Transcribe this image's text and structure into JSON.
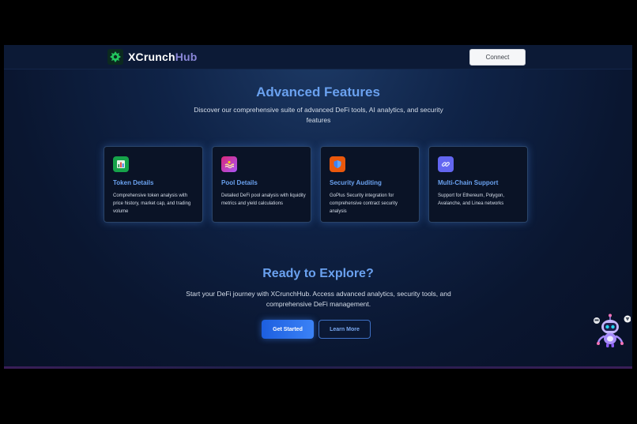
{
  "brand": {
    "name_primary": "XCrunch",
    "name_accent": "Hub"
  },
  "navbar": {
    "connect_label": "Connect"
  },
  "features": {
    "title": "Advanced Features",
    "subtitle": "Discover our comprehensive suite of advanced DeFi tools, AI analytics, and security features",
    "cards": [
      {
        "title": "Token Details",
        "description": "Comprehensive token analysis with price history, market cap, and trading volume",
        "icon": "bar-chart-icon",
        "color": "#16a34a"
      },
      {
        "title": "Pool Details",
        "description": "Detailed DeFi pool analysis with liquidity metrics and yield calculations",
        "icon": "pool-icon",
        "color": "#c026d3"
      },
      {
        "title": "Security Auditing",
        "description": "GoPlus Security integration for comprehensive contract security analysis",
        "icon": "shield-icon",
        "color": "#ea580c"
      },
      {
        "title": "Multi-Chain Support",
        "description": "Support for Ethereum, Polygon, Avalanche, and Linea networks",
        "icon": "link-icon",
        "color": "#6366f1"
      }
    ]
  },
  "explore": {
    "title": "Ready to Explore?",
    "subtitle": "Start your DeFi journey with XCrunchHub. Access advanced analytics, security tools, and comprehensive DeFi management.",
    "primary_label": "Get Started",
    "secondary_label": "Learn More"
  },
  "colors": {
    "accent": "#6aa1ef",
    "primary_button": "#2563eb",
    "background": "#0a1630"
  }
}
